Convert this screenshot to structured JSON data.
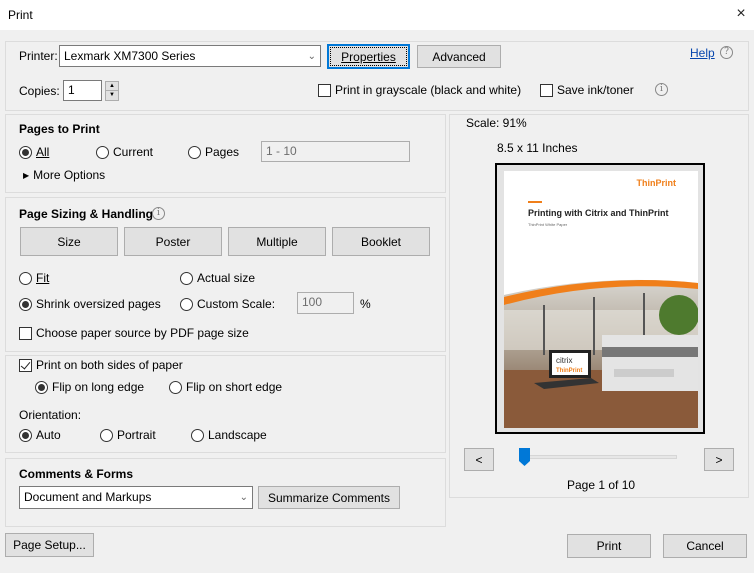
{
  "window": {
    "title": "Print",
    "close_icon": "×"
  },
  "printer": {
    "label": "Printer:",
    "selected": "Lexmark XM7300 Series",
    "properties_label": "Properties",
    "advanced_label": "Advanced",
    "help_label": "Help"
  },
  "copies": {
    "label": "Copies:",
    "value": "1"
  },
  "options": {
    "grayscale_label": "Print in grayscale (black and white)",
    "grayscale_checked": false,
    "save_ink_label": "Save ink/toner",
    "save_ink_checked": false
  },
  "pages_to_print": {
    "heading": "Pages to Print",
    "all_label": "All",
    "current_label": "Current",
    "pages_label": "Pages",
    "pages_value": "1 - 10",
    "selected": "All",
    "more_options_label": "More Options"
  },
  "page_sizing": {
    "heading": "Page Sizing & Handling",
    "tabs": [
      "Size",
      "Poster",
      "Multiple",
      "Booklet"
    ],
    "fit_label": "Fit",
    "actual_size_label": "Actual size",
    "shrink_label": "Shrink oversized pages",
    "custom_scale_label": "Custom Scale:",
    "custom_scale_value": "100",
    "percent_sign": "%",
    "selected": "Shrink oversized pages",
    "paper_source_label": "Choose paper source by PDF page size",
    "paper_source_checked": false
  },
  "duplex": {
    "both_sides_label": "Print on both sides of paper",
    "both_sides_checked": true,
    "long_edge_label": "Flip on long edge",
    "short_edge_label": "Flip on short edge",
    "selected": "Flip on long edge"
  },
  "orientation": {
    "label": "Orientation:",
    "auto_label": "Auto",
    "portrait_label": "Portrait",
    "landscape_label": "Landscape",
    "selected": "Auto"
  },
  "comments_forms": {
    "heading": "Comments & Forms",
    "selected": "Document and Markups",
    "summarize_label": "Summarize Comments"
  },
  "preview": {
    "scale_text": "Scale:  91%",
    "paper_size": "8.5 x 11 Inches",
    "doc_brand": "ThinPrint",
    "doc_title": "Printing with Citrix and ThinPrint",
    "doc_subtitle": "ThinPrint White Paper",
    "laptop_text1": "citrix",
    "laptop_text2": "ThinPrint",
    "prev_label": "<",
    "next_label": ">",
    "page_indicator": "Page 1 of 10",
    "current_page": 1,
    "total_pages": 10,
    "accent_color": "#f07f1a"
  },
  "footer": {
    "page_setup_label": "Page Setup...",
    "print_label": "Print",
    "cancel_label": "Cancel"
  }
}
